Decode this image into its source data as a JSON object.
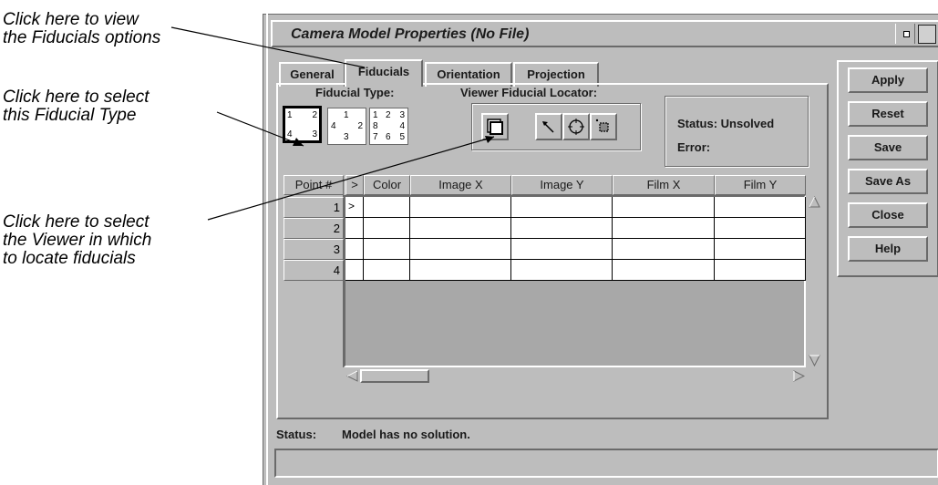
{
  "callouts": {
    "fiducials_tab": [
      "Click here to view",
      "the Fiducials options"
    ],
    "fiducial_type": [
      "Click here to select",
      "this Fiducial Type"
    ],
    "viewer_locator": [
      "Click here to select",
      "the Viewer in which",
      "to locate fiducials"
    ]
  },
  "window": {
    "title": "Camera Model Properties (No File)"
  },
  "tabs": [
    {
      "label": "General",
      "active": false
    },
    {
      "label": "Fiducials",
      "active": true
    },
    {
      "label": "Orientation",
      "active": false
    },
    {
      "label": "Projection",
      "active": false
    }
  ],
  "fiducials": {
    "type_label": "Fiducial Type:",
    "locator_label": "Viewer Fiducial Locator:",
    "status_label": "Status: Unsolved",
    "error_label": "Error:",
    "types": [
      {
        "name": "four-corner",
        "digits": [
          "1",
          "2",
          "4",
          "3"
        ],
        "selected": true
      },
      {
        "name": "four-side",
        "digits": [
          "1",
          "4",
          "2",
          "3"
        ],
        "selected": false
      },
      {
        "name": "eight-point",
        "digits": [
          "1",
          "2",
          "3",
          "8",
          "4",
          "7",
          "6",
          "5"
        ],
        "selected": false
      }
    ]
  },
  "table": {
    "columns": [
      "Point #",
      ">",
      "Color",
      "Image X",
      "Image Y",
      "Film X",
      "Film Y"
    ],
    "rows": [
      {
        "point": "1",
        "marker": ">"
      },
      {
        "point": "2",
        "marker": ""
      },
      {
        "point": "3",
        "marker": ""
      },
      {
        "point": "4",
        "marker": ""
      }
    ]
  },
  "buttons": [
    "Apply",
    "Reset",
    "Save",
    "Save As",
    "Close",
    "Help"
  ],
  "status": {
    "label": "Status:",
    "text": "Model has no solution."
  },
  "colors": {
    "panel": "#bdbdbd",
    "table_empty": "#a8a8a8",
    "cell": "#ffffff"
  },
  "icons": [
    "window-menu-icon",
    "maximize-icon",
    "viewer-select-icon",
    "locate-arrow-icon",
    "crosshair-circle-icon",
    "drive-point-icon"
  ]
}
